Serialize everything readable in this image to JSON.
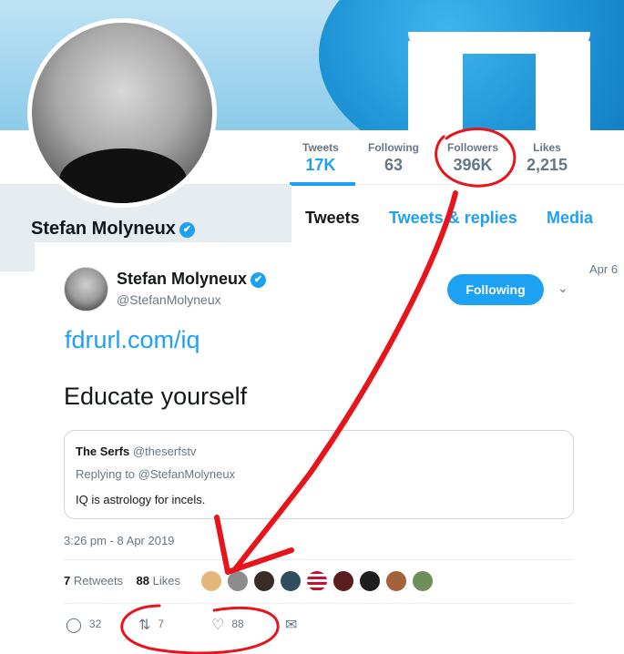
{
  "profile": {
    "name": "Stefan Molyneux",
    "verified_mark": "✔",
    "stats": [
      {
        "label": "Tweets",
        "value": "17K"
      },
      {
        "label": "Following",
        "value": "63"
      },
      {
        "label": "Followers",
        "value": "396K"
      },
      {
        "label": "Likes",
        "value": "2,215"
      }
    ],
    "tabs": [
      "Tweets",
      "Tweets & replies",
      "Media"
    ]
  },
  "tweet": {
    "date_partial": "Apr 6",
    "author_name": "Stefan Molyneux",
    "author_handle": "@StefanMolyneux",
    "follow_label": "Following",
    "caret_icon": "chevron-down-icon",
    "link_text": "fdrurl.com/iq",
    "body_text": "Educate yourself",
    "quote": {
      "author": "The Serfs",
      "handle": "@theserfstv",
      "replying_to": "Replying to @StefanMolyneux",
      "text": "IQ is astrology for incels."
    },
    "timestamp": "3:26 pm - 8 Apr 2019",
    "retweets_count": "7",
    "retweets_label": "Retweets",
    "likes_count": "88",
    "likes_label": "Likes",
    "actions": {
      "reply_count": "32",
      "retweet_count": "7",
      "like_count": "88"
    }
  },
  "colors": {
    "accent": "#1da1f2",
    "annotation": "#e8141c"
  }
}
